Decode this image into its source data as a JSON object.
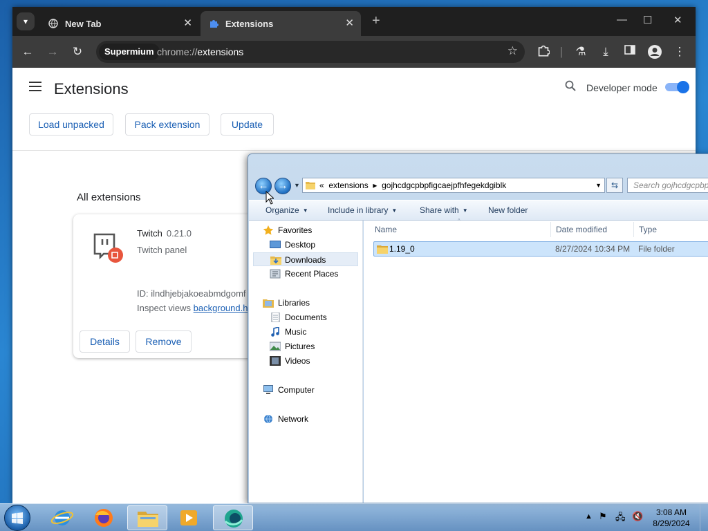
{
  "browser": {
    "tabs": [
      {
        "label": "New Tab",
        "active": false
      },
      {
        "label": "Extensions",
        "active": true
      }
    ],
    "omnibox": {
      "chip": "Supermium",
      "url_prefix": "chrome://",
      "url_path": "extensions"
    }
  },
  "extensions_page": {
    "title": "Extensions",
    "developer_mode_label": "Developer mode",
    "developer_mode_on": true,
    "buttons": {
      "load_unpacked": "Load unpacked",
      "pack_extension": "Pack extension",
      "update": "Update"
    },
    "section_title": "All extensions",
    "card": {
      "name": "Twitch",
      "version": "0.21.0",
      "description": "Twitch panel",
      "id_text": "ID: ilndhjebjakoeabmdgomf",
      "inspect_label": "Inspect views",
      "inspect_link": "background.h",
      "details_label": "Details",
      "remove_label": "Remove"
    }
  },
  "explorer": {
    "address": {
      "sep": "«",
      "crumb1": "extensions",
      "arrow": "▸",
      "crumb2": "gojhcdgcpbpfigcaejpfhfegekdgiblk"
    },
    "search_placeholder": "Search gojhcdgcpbpfigcaejpfhfegekdgiblk",
    "commands": {
      "organize": "Organize",
      "include": "Include in library",
      "share": "Share with",
      "new_folder": "New folder"
    },
    "nav": {
      "favorites": "Favorites",
      "desktop": "Desktop",
      "downloads": "Downloads",
      "recent": "Recent Places",
      "libraries": "Libraries",
      "documents": "Documents",
      "music": "Music",
      "pictures": "Pictures",
      "videos": "Videos",
      "computer": "Computer",
      "network": "Network"
    },
    "columns": {
      "name": "Name",
      "date": "Date modified",
      "type": "Type"
    },
    "files": [
      {
        "name": "1.19_0",
        "date": "8/27/2024 10:34 PM",
        "type": "File folder"
      }
    ]
  },
  "taskbar": {
    "time": "3:08 AM",
    "date": "8/29/2024"
  }
}
